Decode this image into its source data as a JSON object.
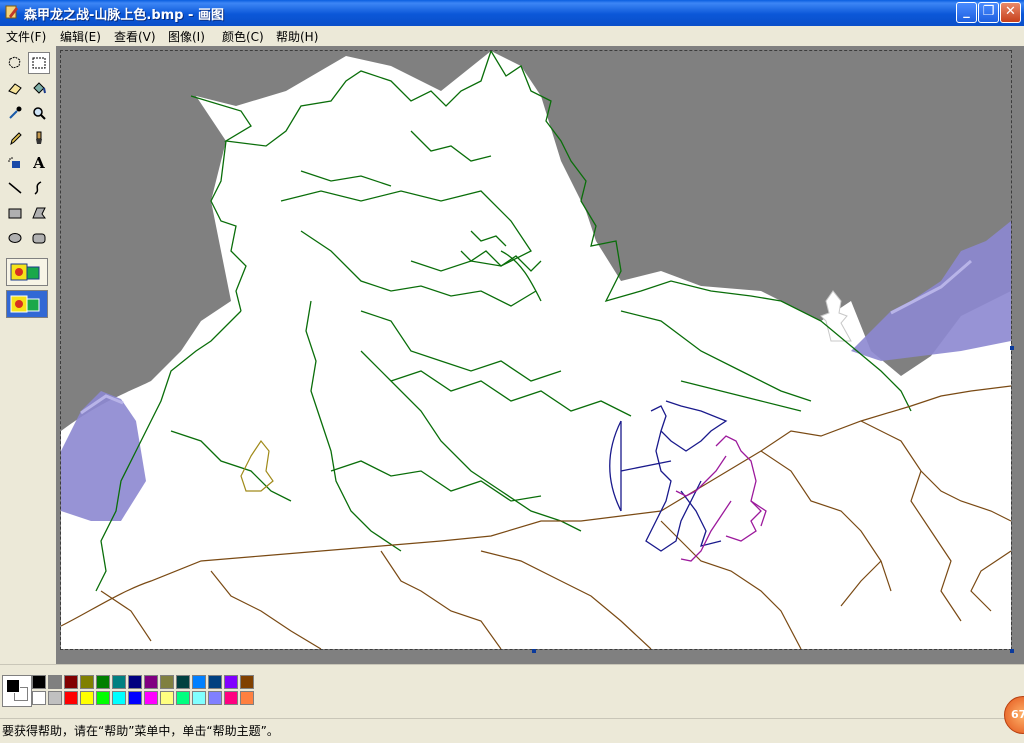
{
  "window": {
    "title": "森甲龙之战-山脉上色.bmp - 画图",
    "minimize_label": "_",
    "maximize_label": "❐",
    "close_label": "✕"
  },
  "menu": [
    {
      "label": "文件(F)"
    },
    {
      "label": "编辑(E)"
    },
    {
      "label": "查看(V)"
    },
    {
      "label": "图像(I)"
    },
    {
      "label": "颜色(C)"
    },
    {
      "label": "帮助(H)"
    }
  ],
  "tools": [
    {
      "name": "free-form-select-icon"
    },
    {
      "name": "rectangle-select-icon",
      "selected": true
    },
    {
      "name": "eraser-icon"
    },
    {
      "name": "fill-bucket-icon"
    },
    {
      "name": "color-picker-icon"
    },
    {
      "name": "magnifier-icon"
    },
    {
      "name": "pencil-icon"
    },
    {
      "name": "brush-icon"
    },
    {
      "name": "airbrush-icon"
    },
    {
      "name": "text-icon",
      "glyph": "A"
    },
    {
      "name": "line-icon"
    },
    {
      "name": "curve-icon"
    },
    {
      "name": "rectangle-icon"
    },
    {
      "name": "polygon-icon"
    },
    {
      "name": "ellipse-icon"
    },
    {
      "name": "rounded-rectangle-icon"
    }
  ],
  "palette": {
    "foreground": "#000000",
    "background": "#ffffff",
    "top_row": [
      "#000000",
      "#808080",
      "#800000",
      "#808000",
      "#008000",
      "#008080",
      "#000080",
      "#800080",
      "#808040",
      "#004040",
      "#0080ff",
      "#004080",
      "#8000ff",
      "#804000"
    ],
    "bottom_row": [
      "#ffffff",
      "#c0c0c0",
      "#ff0000",
      "#ffff00",
      "#00ff00",
      "#00ffff",
      "#0000ff",
      "#ff00ff",
      "#ffff80",
      "#00ff80",
      "#80ffff",
      "#8080ff",
      "#ff0080",
      "#ff8040"
    ]
  },
  "status": {
    "help_text": "要获得帮助，请在“帮助”菜单中，单击“帮助主题”。",
    "badge_text": "67"
  },
  "colors": {
    "sky": "#808080",
    "dragon_outline": "#0a6e0a",
    "ground_outline": "#7a4a14",
    "mountain": "#8c87d0",
    "archer_outline": "#1a1a8c",
    "companion_outline": "#9c1a9c"
  }
}
